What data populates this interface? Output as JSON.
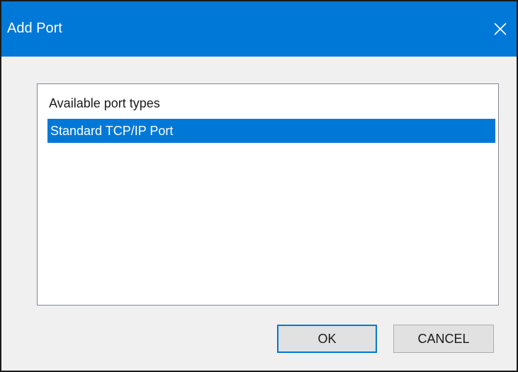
{
  "window": {
    "title": "Add Port",
    "close_icon": "close-icon"
  },
  "list": {
    "header": "Available port types",
    "items": [
      {
        "label": "Standard TCP/IP Port",
        "selected": true
      }
    ]
  },
  "buttons": {
    "ok_label": "OK",
    "cancel_label": "CANCEL"
  },
  "colors": {
    "accent": "#0078d7",
    "dialog_bg": "#f0f0f0",
    "button_bg": "#e1e1e1"
  }
}
